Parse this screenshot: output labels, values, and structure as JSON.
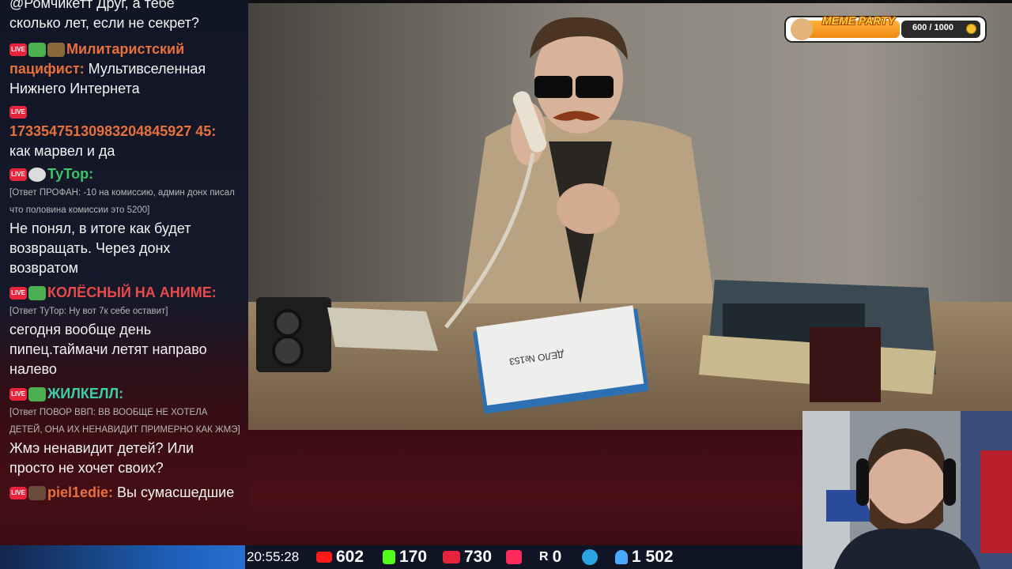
{
  "chat": {
    "top_partial": {
      "line1": "@Ромчикетт Друг, а тебе",
      "line2": "сколько лет, если не секрет?"
    },
    "messages": [
      {
        "nick": "Милитаристский пацифист:",
        "nick_color": "#e8703a",
        "text": "Мультивселенная Нижнего Интернета"
      },
      {
        "nick": "17335475130983204845927 45:",
        "nick_color": "#e8703a",
        "text": "как марвел и да"
      },
      {
        "nick": "ТуТор:",
        "nick_color": "#3cc46a",
        "reply": "[Ответ ПРОФАН: -10 на комиссию, админ донх писал что половина комиссии это 5200]",
        "text": "Не понял, в итоге как будет возвращать. Через донх возвратом"
      },
      {
        "nick": "КОЛЁСНЫЙ НА АНИМЕ:",
        "nick_color": "#e84a4a",
        "reply": "[Ответ ТуТор: Ну вот 7к себе оставит]",
        "text": "сегодня вообще день пипец.таймачи летят направо налево"
      },
      {
        "nick": "ЖИЛКЕЛЛ:",
        "nick_color": "#3ad0a8",
        "reply": "[Ответ ПОВОР ВВП: ВВ ВООБЩЕ НЕ ХОТЕЛА ДЕТЕЙ, ОНА ИХ НЕНАВИДИТ ПРИМЕРНО КАК ЖМЭ]",
        "text": "Жмэ ненавидит детей? Или просто не хочет своих?"
      },
      {
        "nick": "piel1edie:",
        "nick_color": "#e8703a",
        "text": "Вы сумасшедшие"
      }
    ]
  },
  "live_label": "LIVE",
  "meme_party": {
    "title": "MEME PARTY",
    "progress": "600 / 1000",
    "fraction": 0.6
  },
  "status_bar": {
    "time": "20:55:28",
    "youtube": "602",
    "kick": "170",
    "vk_live": "730",
    "rutube": "0",
    "telegram": "",
    "viewers": "1 502",
    "extra_r": "R"
  },
  "video": {
    "folder_label": "ДЕЛО №153"
  }
}
